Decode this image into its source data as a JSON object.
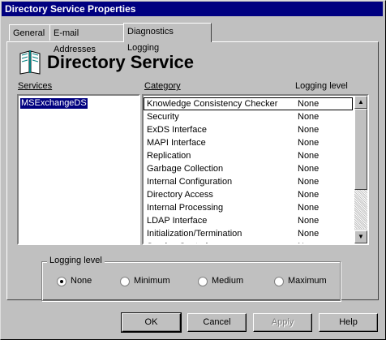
{
  "window": {
    "title": "Directory Service Properties"
  },
  "tabs": [
    {
      "label": "General"
    },
    {
      "label": "E-mail Addresses"
    },
    {
      "label": "Diagnostics Logging"
    }
  ],
  "header": {
    "title": "Directory Service",
    "icon": "book-icon"
  },
  "services": {
    "label": "Services",
    "items": [
      "MSExchangeDS"
    ]
  },
  "category": {
    "label": "Category",
    "level_label": "Logging level",
    "rows": [
      {
        "name": "Knowledge Consistency Checker",
        "level": "None"
      },
      {
        "name": "Security",
        "level": "None"
      },
      {
        "name": "ExDS Interface",
        "level": "None"
      },
      {
        "name": "MAPI Interface",
        "level": "None"
      },
      {
        "name": "Replication",
        "level": "None"
      },
      {
        "name": "Garbage Collection",
        "level": "None"
      },
      {
        "name": "Internal Configuration",
        "level": "None"
      },
      {
        "name": "Directory Access",
        "level": "None"
      },
      {
        "name": "Internal Processing",
        "level": "None"
      },
      {
        "name": "LDAP Interface",
        "level": "None"
      },
      {
        "name": "Initialization/Termination",
        "level": "None"
      },
      {
        "name": "Service Control",
        "level": "None"
      }
    ]
  },
  "logging": {
    "title": "Logging level",
    "options": [
      {
        "label": "None",
        "selected": true
      },
      {
        "label": "Minimum",
        "selected": false
      },
      {
        "label": "Medium",
        "selected": false
      },
      {
        "label": "Maximum",
        "selected": false
      }
    ]
  },
  "buttons": {
    "ok": "OK",
    "cancel": "Cancel",
    "apply": "Apply",
    "help": "Help"
  }
}
